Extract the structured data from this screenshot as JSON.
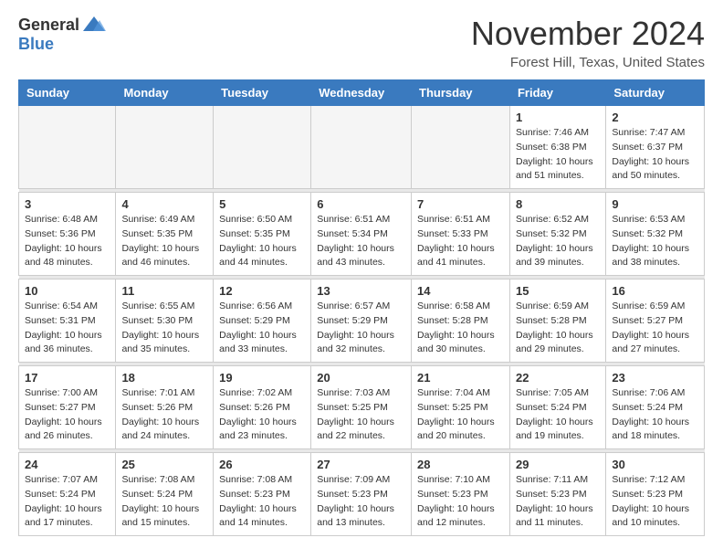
{
  "header": {
    "logo_general": "General",
    "logo_blue": "Blue",
    "month_title": "November 2024",
    "location": "Forest Hill, Texas, United States"
  },
  "weekdays": [
    "Sunday",
    "Monday",
    "Tuesday",
    "Wednesday",
    "Thursday",
    "Friday",
    "Saturday"
  ],
  "weeks": [
    [
      {
        "day": "",
        "info": ""
      },
      {
        "day": "",
        "info": ""
      },
      {
        "day": "",
        "info": ""
      },
      {
        "day": "",
        "info": ""
      },
      {
        "day": "",
        "info": ""
      },
      {
        "day": "1",
        "info": "Sunrise: 7:46 AM\nSunset: 6:38 PM\nDaylight: 10 hours\nand 51 minutes."
      },
      {
        "day": "2",
        "info": "Sunrise: 7:47 AM\nSunset: 6:37 PM\nDaylight: 10 hours\nand 50 minutes."
      }
    ],
    [
      {
        "day": "3",
        "info": "Sunrise: 6:48 AM\nSunset: 5:36 PM\nDaylight: 10 hours\nand 48 minutes."
      },
      {
        "day": "4",
        "info": "Sunrise: 6:49 AM\nSunset: 5:35 PM\nDaylight: 10 hours\nand 46 minutes."
      },
      {
        "day": "5",
        "info": "Sunrise: 6:50 AM\nSunset: 5:35 PM\nDaylight: 10 hours\nand 44 minutes."
      },
      {
        "day": "6",
        "info": "Sunrise: 6:51 AM\nSunset: 5:34 PM\nDaylight: 10 hours\nand 43 minutes."
      },
      {
        "day": "7",
        "info": "Sunrise: 6:51 AM\nSunset: 5:33 PM\nDaylight: 10 hours\nand 41 minutes."
      },
      {
        "day": "8",
        "info": "Sunrise: 6:52 AM\nSunset: 5:32 PM\nDaylight: 10 hours\nand 39 minutes."
      },
      {
        "day": "9",
        "info": "Sunrise: 6:53 AM\nSunset: 5:32 PM\nDaylight: 10 hours\nand 38 minutes."
      }
    ],
    [
      {
        "day": "10",
        "info": "Sunrise: 6:54 AM\nSunset: 5:31 PM\nDaylight: 10 hours\nand 36 minutes."
      },
      {
        "day": "11",
        "info": "Sunrise: 6:55 AM\nSunset: 5:30 PM\nDaylight: 10 hours\nand 35 minutes."
      },
      {
        "day": "12",
        "info": "Sunrise: 6:56 AM\nSunset: 5:29 PM\nDaylight: 10 hours\nand 33 minutes."
      },
      {
        "day": "13",
        "info": "Sunrise: 6:57 AM\nSunset: 5:29 PM\nDaylight: 10 hours\nand 32 minutes."
      },
      {
        "day": "14",
        "info": "Sunrise: 6:58 AM\nSunset: 5:28 PM\nDaylight: 10 hours\nand 30 minutes."
      },
      {
        "day": "15",
        "info": "Sunrise: 6:59 AM\nSunset: 5:28 PM\nDaylight: 10 hours\nand 29 minutes."
      },
      {
        "day": "16",
        "info": "Sunrise: 6:59 AM\nSunset: 5:27 PM\nDaylight: 10 hours\nand 27 minutes."
      }
    ],
    [
      {
        "day": "17",
        "info": "Sunrise: 7:00 AM\nSunset: 5:27 PM\nDaylight: 10 hours\nand 26 minutes."
      },
      {
        "day": "18",
        "info": "Sunrise: 7:01 AM\nSunset: 5:26 PM\nDaylight: 10 hours\nand 24 minutes."
      },
      {
        "day": "19",
        "info": "Sunrise: 7:02 AM\nSunset: 5:26 PM\nDaylight: 10 hours\nand 23 minutes."
      },
      {
        "day": "20",
        "info": "Sunrise: 7:03 AM\nSunset: 5:25 PM\nDaylight: 10 hours\nand 22 minutes."
      },
      {
        "day": "21",
        "info": "Sunrise: 7:04 AM\nSunset: 5:25 PM\nDaylight: 10 hours\nand 20 minutes."
      },
      {
        "day": "22",
        "info": "Sunrise: 7:05 AM\nSunset: 5:24 PM\nDaylight: 10 hours\nand 19 minutes."
      },
      {
        "day": "23",
        "info": "Sunrise: 7:06 AM\nSunset: 5:24 PM\nDaylight: 10 hours\nand 18 minutes."
      }
    ],
    [
      {
        "day": "24",
        "info": "Sunrise: 7:07 AM\nSunset: 5:24 PM\nDaylight: 10 hours\nand 17 minutes."
      },
      {
        "day": "25",
        "info": "Sunrise: 7:08 AM\nSunset: 5:24 PM\nDaylight: 10 hours\nand 15 minutes."
      },
      {
        "day": "26",
        "info": "Sunrise: 7:08 AM\nSunset: 5:23 PM\nDaylight: 10 hours\nand 14 minutes."
      },
      {
        "day": "27",
        "info": "Sunrise: 7:09 AM\nSunset: 5:23 PM\nDaylight: 10 hours\nand 13 minutes."
      },
      {
        "day": "28",
        "info": "Sunrise: 7:10 AM\nSunset: 5:23 PM\nDaylight: 10 hours\nand 12 minutes."
      },
      {
        "day": "29",
        "info": "Sunrise: 7:11 AM\nSunset: 5:23 PM\nDaylight: 10 hours\nand 11 minutes."
      },
      {
        "day": "30",
        "info": "Sunrise: 7:12 AM\nSunset: 5:23 PM\nDaylight: 10 hours\nand 10 minutes."
      }
    ]
  ]
}
